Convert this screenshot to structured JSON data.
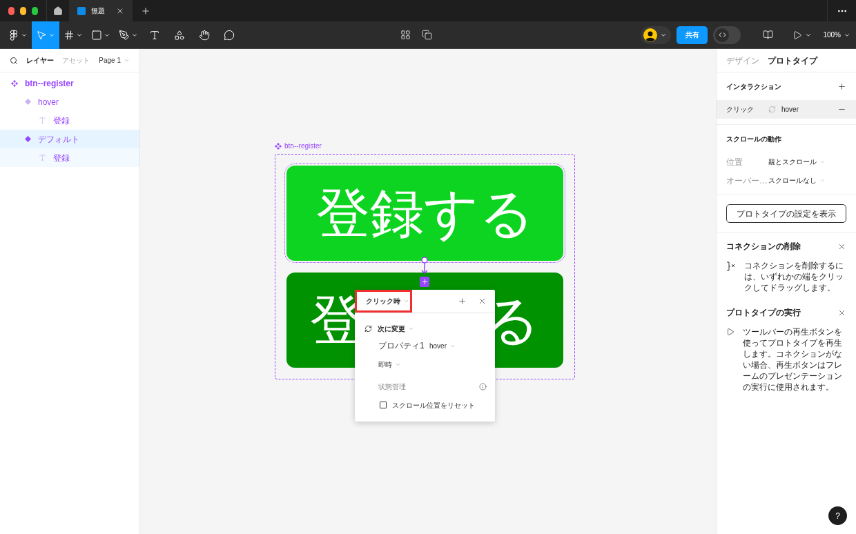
{
  "titlebar": {
    "tabs": [
      {
        "title": "無題",
        "selected": true
      }
    ]
  },
  "toolbar": {
    "tools": [
      {
        "kind": "main-menu",
        "selected": false
      },
      {
        "kind": "move",
        "selected": true
      },
      {
        "kind": "frame",
        "selected": false
      },
      {
        "kind": "shape",
        "selected": false
      },
      {
        "kind": "pen",
        "selected": false
      },
      {
        "kind": "text",
        "selected": false
      },
      {
        "kind": "resources",
        "selected": false
      },
      {
        "kind": "hand",
        "selected": false
      },
      {
        "kind": "comment",
        "selected": false
      }
    ],
    "share_button": "共有",
    "dev_mode": false,
    "zoom": "100%"
  },
  "left_panel": {
    "tabs": [
      {
        "label": "レイヤー",
        "selected": true
      },
      {
        "label": "アセット",
        "selected": false
      }
    ],
    "page": "Page 1",
    "layers": [
      {
        "name": "btn--register",
        "kind": "component-set",
        "selected": false,
        "children": [
          {
            "name": "hover",
            "kind": "variant",
            "selected": false,
            "children": [
              {
                "name": "登録",
                "kind": "text",
                "selected": false
              }
            ]
          },
          {
            "name": "デフォルト",
            "kind": "variant",
            "selected": true,
            "children": [
              {
                "name": "登録",
                "kind": "text",
                "selected": false
              }
            ]
          }
        ]
      }
    ]
  },
  "canvas": {
    "component_label": "btn--register",
    "variants": [
      {
        "texts": [
          "登録する"
        ],
        "color": "#0dd420",
        "selected": true
      },
      {
        "texts": [
          "登",
          "る"
        ],
        "color": "#009200",
        "selected": false
      }
    ]
  },
  "popup": {
    "trigger": "クリック時",
    "trigger_highlighted": true,
    "action": "次に変更",
    "property_label": "プロパティ1",
    "property_value": "hover",
    "animation": "即時",
    "state_label": "状態管理",
    "reset_scroll": {
      "label": "スクロール位置をリセット",
      "checked": false
    }
  },
  "right_panel": {
    "tabs": [
      {
        "label": "デザイン",
        "selected": false
      },
      {
        "label": "プロトタイプ",
        "selected": true
      }
    ],
    "interactions_title": "インタラクション",
    "interactions": [
      {
        "trigger": "クリック",
        "target": "hover"
      }
    ],
    "scroll_title": "スクロールの動作",
    "scroll_rows": [
      {
        "label": "位置",
        "value": "親とスクロール"
      },
      {
        "label": "オーバー…",
        "value": "スクロールなし"
      }
    ],
    "settings_button": "プロトタイプの設定を表示",
    "hints": [
      {
        "kind": "connection",
        "title": "コネクションの削除",
        "text": "コネクションを削除するには、いずれかの端をクリックしてドラッグします。"
      },
      {
        "kind": "play",
        "title": "プロトタイプの実行",
        "text": "ツールバーの再生ボタンを使ってプロトタイプを再生します。コネクションがない場合、再生ボタンはフレームのプレゼンテーションの実行に使用されます。"
      }
    ]
  },
  "help_button": "?"
}
